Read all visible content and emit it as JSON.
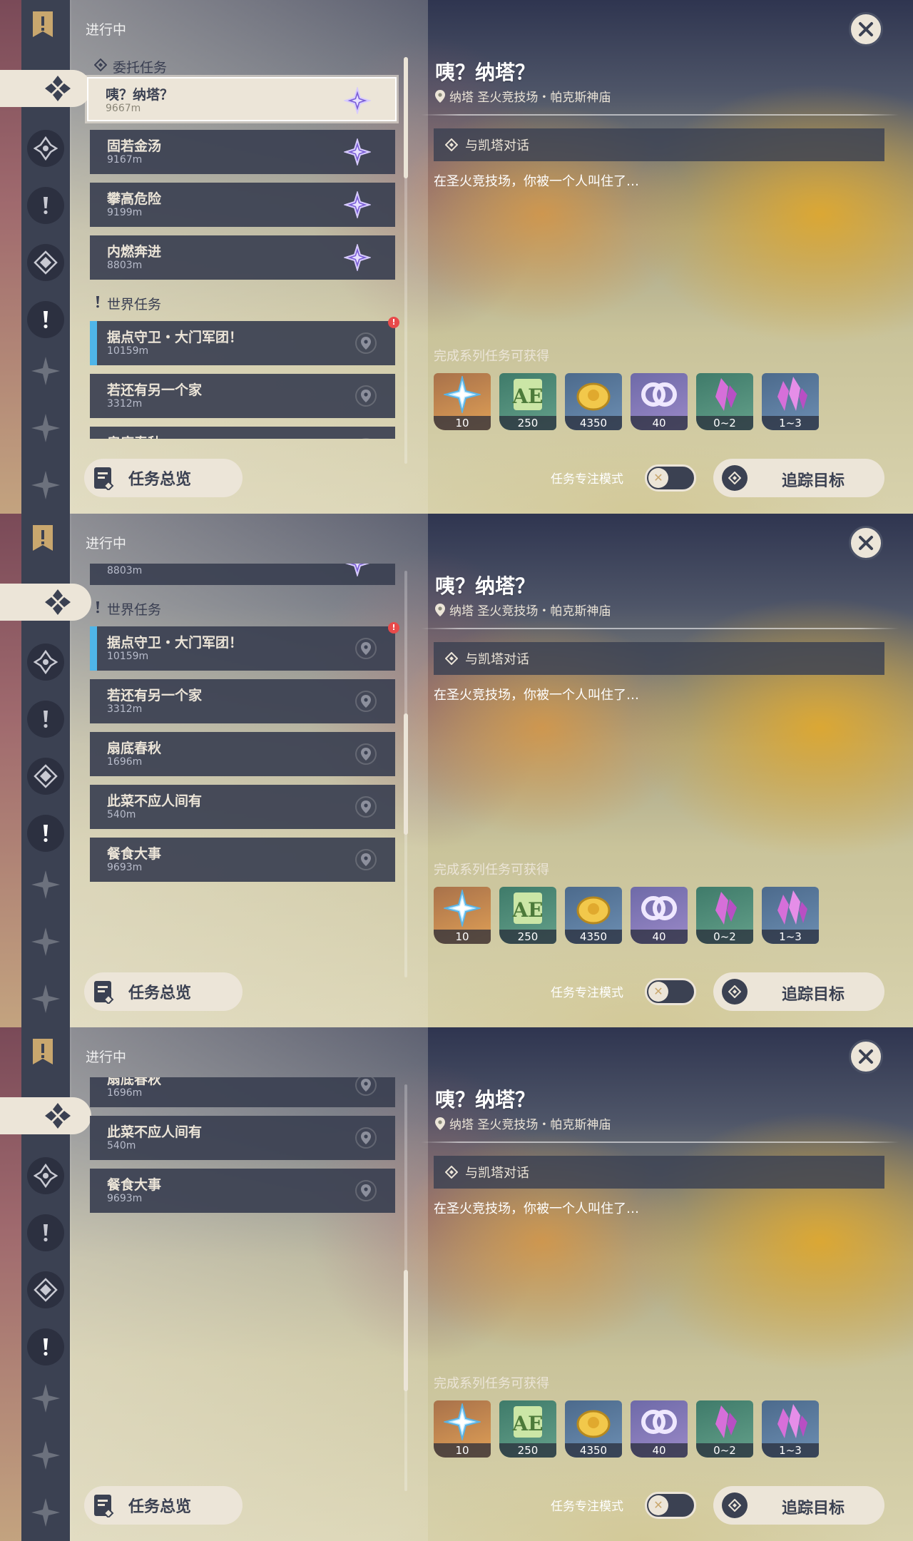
{
  "header": {
    "in_progress": "进行中"
  },
  "categories": {
    "commission": "委托任务",
    "world": "世界任务"
  },
  "quests": [
    {
      "title": "咦？纳塔？",
      "dist": "9667m"
    },
    {
      "title": "固若金汤",
      "dist": "9167m"
    },
    {
      "title": "攀高危险",
      "dist": "9199m"
    },
    {
      "title": "内燃奔进",
      "dist": "8803m"
    },
    {
      "title": "据点守卫・大门军团！",
      "dist": "10159m"
    },
    {
      "title": "若还有另一个家",
      "dist": "3312m"
    },
    {
      "title": "扇底春秋",
      "dist": "1696m"
    },
    {
      "title": "此菜不应人间有",
      "dist": "540m"
    },
    {
      "title": "餐食大事",
      "dist": "9693m"
    }
  ],
  "detail": {
    "title": "咦？纳塔？",
    "location": "纳塔 圣火竞技场・帕克斯神庙",
    "objective": "与凯塔对话",
    "description": "在圣火竞技场，你被一个人叫住了…",
    "rewards_label": "完成系列任务可获得",
    "rewards": [
      {
        "name": "primogem",
        "qty": "10"
      },
      {
        "name": "adventure-exp",
        "qty": "250"
      },
      {
        "name": "mora",
        "qty": "4350"
      },
      {
        "name": "fetter-exp",
        "qty": "40"
      },
      {
        "name": "crystal-small",
        "qty": "0~2"
      },
      {
        "name": "crystal-large",
        "qty": "1~3"
      }
    ]
  },
  "footer": {
    "overview": "任务总览",
    "focus_mode": "任务专注模式",
    "track": "追踪目标"
  },
  "colors": {
    "panel": "#3b4152",
    "cream": "#ece5d8",
    "accent_blue": "#4fb5e8",
    "alert": "#e84a4a"
  }
}
